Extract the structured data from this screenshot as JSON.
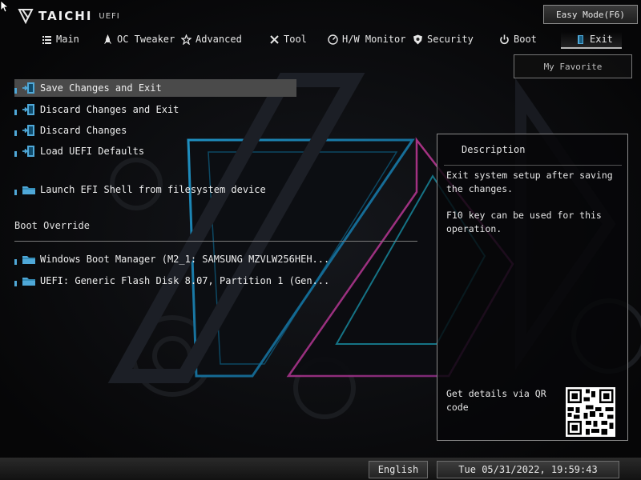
{
  "header": {
    "brand": "TAICHI",
    "brand_sub": "UEFI",
    "easy_mode_label": "Easy Mode(F6)"
  },
  "tabs": [
    {
      "label": "Main",
      "icon": "list-icon"
    },
    {
      "label": "OC Tweaker",
      "icon": "rocket-icon"
    },
    {
      "label": "Advanced",
      "icon": "star-icon"
    },
    {
      "label": "Tool",
      "icon": "wrench-icon"
    },
    {
      "label": "H/W Monitor",
      "icon": "monitor-icon"
    },
    {
      "label": "Security",
      "icon": "shield-icon"
    },
    {
      "label": "Boot",
      "icon": "power-icon"
    },
    {
      "label": "Exit",
      "icon": "exit-icon",
      "active": true
    }
  ],
  "my_favorite_label": "My Favorite",
  "menu": {
    "items": [
      {
        "label": "Save Changes and Exit",
        "icon": "exit-door-icon",
        "selected": true
      },
      {
        "label": "Discard Changes and Exit",
        "icon": "exit-door-icon"
      },
      {
        "label": "Discard Changes",
        "icon": "exit-door-icon"
      },
      {
        "label": "Load UEFI Defaults",
        "icon": "exit-door-icon"
      },
      {
        "label": "Launch EFI Shell from filesystem device",
        "icon": "folder-icon"
      }
    ],
    "boot_override_label": "Boot Override",
    "boot_items": [
      {
        "label": "Windows Boot Manager (M2_1: SAMSUNG MZVLW256HEH...",
        "icon": "folder-icon"
      },
      {
        "label": "UEFI: Generic Flash Disk 8.07, Partition 1 (Gen...",
        "icon": "folder-icon"
      }
    ]
  },
  "description": {
    "title": "Description",
    "paragraphs": [
      "Exit system setup after saving the changes.",
      "F10 key can be used for this operation."
    ],
    "qr_label": "Get details via QR code"
  },
  "footer": {
    "language": "English",
    "datetime": "Tue 05/31/2022, 19:59:43"
  },
  "colors": {
    "accent_blue": "#4fa8d8",
    "panel_border": "#8a8a8a",
    "selected_row": "#4a4a4a"
  }
}
